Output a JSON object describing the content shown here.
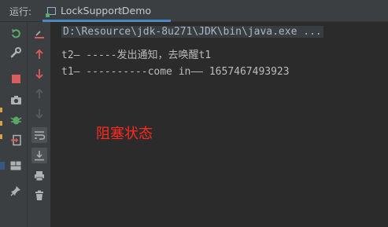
{
  "topbar": {
    "run_label": "运行:",
    "tab_label": "LockSupportDemo",
    "tab_close": "×"
  },
  "console": {
    "command": "D:\\Resource\\jdk-8u271\\JDK\\bin\\java.exe ...",
    "lines": [
      "t2— -----发出通知，去唤醒t1",
      "t1— ----------come in—— 1657467493923"
    ]
  },
  "annotation": "阻塞状态",
  "colors": {
    "background": "#2b2b2b",
    "toolbar": "#3c3f41",
    "tab_accent": "#4a88c7",
    "annotation": "#ff2a1f",
    "rerun": "#59a869",
    "stop": "#db5c5c"
  },
  "icons": {
    "left": [
      "rerun-icon",
      "wrench-icon",
      "stop-icon",
      "camera-icon",
      "debug-icon",
      "exit-icon",
      "layout-icon",
      "pin-icon"
    ],
    "second": [
      "clear-icon",
      "up-arrow-icon",
      "down-arrow-icon",
      "up-disabled-icon",
      "down-disabled-icon",
      "soft-wrap-icon",
      "scroll-to-end-icon",
      "print-icon",
      "trash-icon"
    ]
  }
}
